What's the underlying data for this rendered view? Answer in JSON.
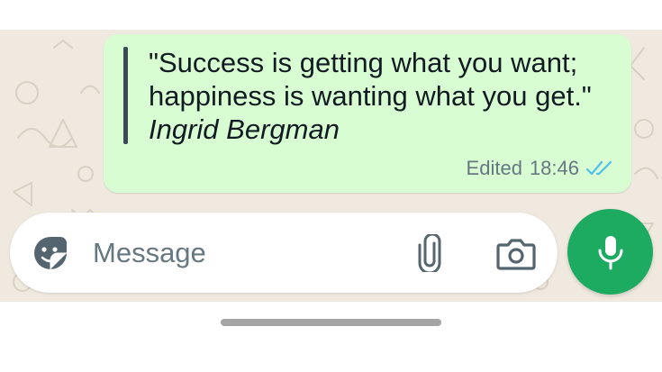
{
  "message": {
    "quote_text": "\"Success is getting what you want; happiness is wanting what you get.\"",
    "author": "Ingrid Bergman",
    "status_label": "Edited",
    "time": "18:46",
    "read_status_icon": "double-check-read-icon",
    "read_tick_color": "#53bdeb",
    "bubble_color": "#d9fdd3"
  },
  "composer": {
    "placeholder": "Message",
    "value": "",
    "sticker_icon": "sticker-icon",
    "attach_icon": "paperclip-icon",
    "camera_icon": "camera-icon",
    "mic_icon": "mic-icon",
    "mic_button_color": "#1daa61"
  }
}
